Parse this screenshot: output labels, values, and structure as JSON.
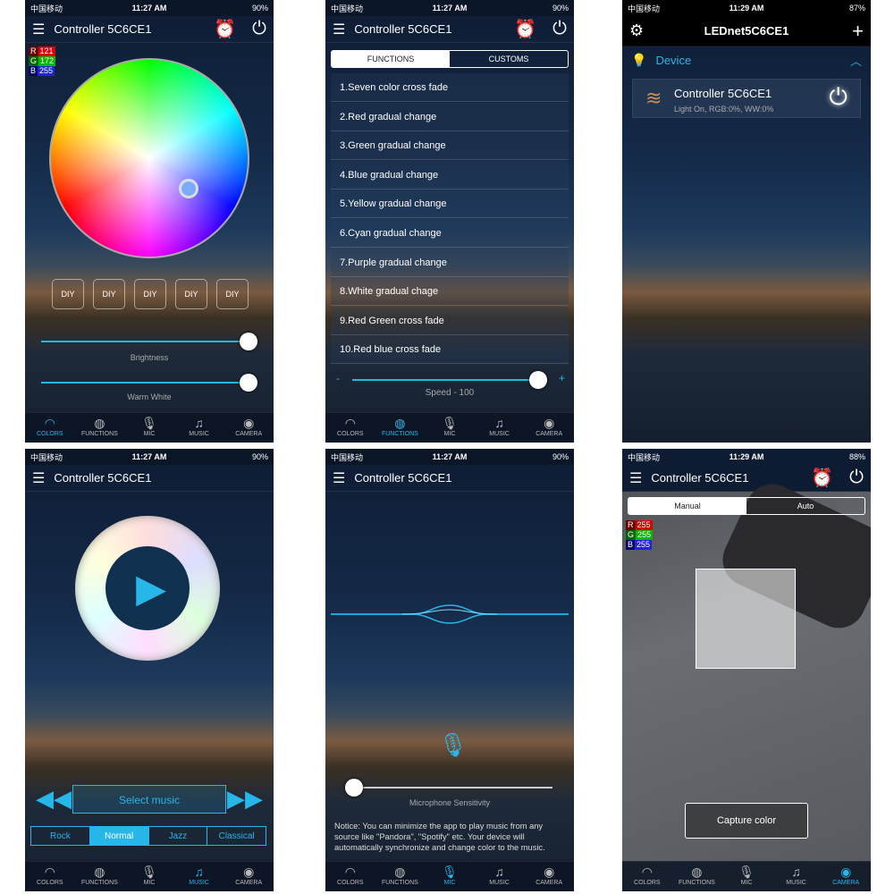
{
  "carrier": "中国移动",
  "tabs": [
    "COLORS",
    "FUNCTIONS",
    "MIC",
    "MUSIC",
    "CAMERA"
  ],
  "colors": {
    "time": "11:27 AM",
    "battery": "90%",
    "title": "Controller 5C6CE1",
    "r_label": "R",
    "g_label": "G",
    "b_label": "B",
    "r": "121",
    "g": "172",
    "b": "255",
    "diy": [
      "DIY",
      "DIY",
      "DIY",
      "DIY",
      "DIY"
    ],
    "brightness_label": "Brightness",
    "brightness": 100,
    "warm_label": "Warm White",
    "warm": 100
  },
  "functions": {
    "time": "11:27 AM",
    "battery": "90%",
    "title": "Controller 5C6CE1",
    "seg": [
      "FUNCTIONS",
      "CUSTOMS"
    ],
    "items": [
      "1.Seven color cross fade",
      "2.Red gradual change",
      "3.Green gradual change",
      "4.Blue gradual change",
      "5.Yellow gradual change",
      "6.Cyan gradual change",
      "7.Purple gradual change",
      "8.White gradual chage",
      "9.Red Green cross fade",
      "10.Red blue cross fade"
    ],
    "minus": "-",
    "plus": "+",
    "speed_label": "Speed - 100",
    "speed": 100
  },
  "device": {
    "time": "11:29 AM",
    "battery": "87%",
    "title": "LEDnet5C6CE1",
    "section": "Device",
    "name": "Controller 5C6CE1",
    "status": "Light On, RGB:0%, WW:0%"
  },
  "music": {
    "time": "11:27 AM",
    "battery": "90%",
    "title": "Controller 5C6CE1",
    "select": "Select music",
    "genres": [
      "Rock",
      "Normal",
      "Jazz",
      "Classical"
    ],
    "selected_genre": "Normal"
  },
  "mic": {
    "time": "11:27 AM",
    "battery": "90%",
    "title": "Controller 5C6CE1",
    "sensitivity_label": "Microphone Sensitivity",
    "sensitivity": 0,
    "notice": "Notice: You can minimize the app to play music from any source like \"Pandora\", \"Spotify\" etc. Your device will automatically synchronize and change color to the music."
  },
  "camera": {
    "time": "11:29 AM",
    "battery": "88%",
    "title": "Controller 5C6CE1",
    "seg": [
      "Manual",
      "Auto"
    ],
    "r": "255",
    "g": "255",
    "b": "255",
    "capture": "Capture color"
  },
  "accent": "#27b6e8"
}
